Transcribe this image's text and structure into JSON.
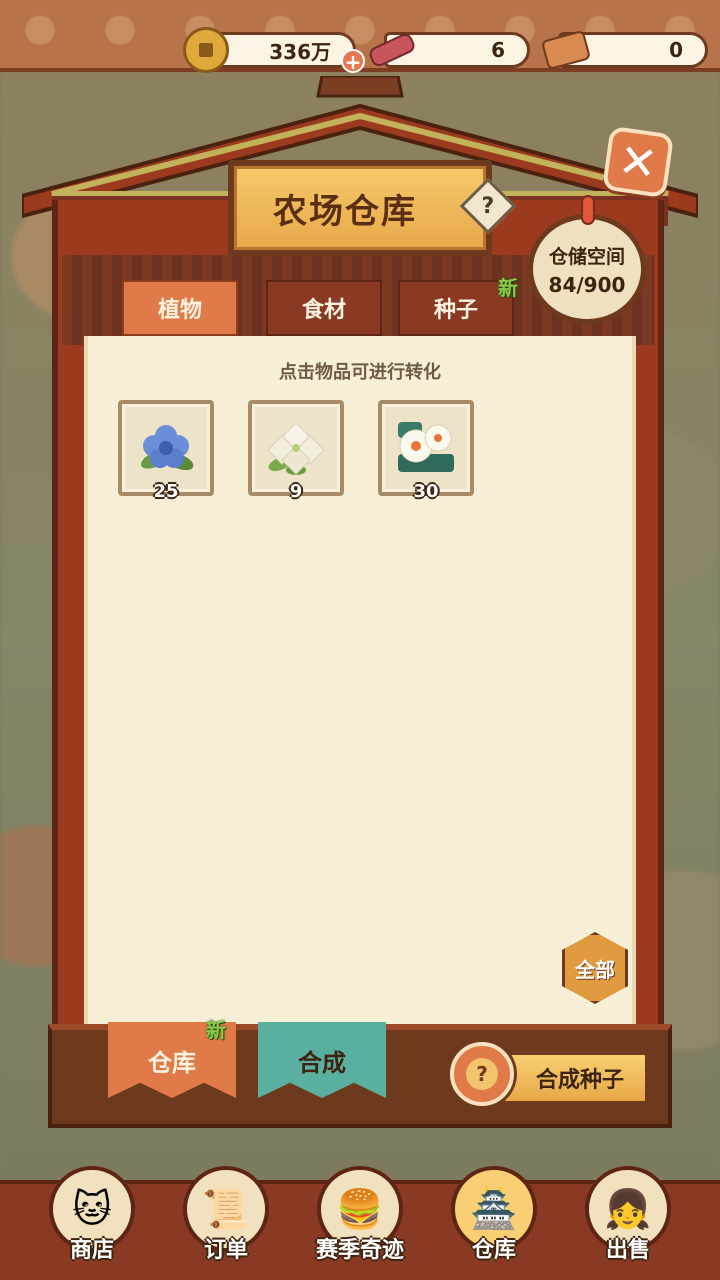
{
  "resources": {
    "coins": "336万",
    "bones": "6",
    "scrolls": "0"
  },
  "panel": {
    "title": "农场仓库",
    "storage_label": "仓储空间",
    "storage_value": "84/900",
    "hint": "点击物品可进行转化"
  },
  "tabs": [
    {
      "label": "植物",
      "active": true
    },
    {
      "label": "食材",
      "active": false
    },
    {
      "label": "种子",
      "active": false,
      "badge": "新"
    }
  ],
  "items": [
    {
      "icon": "blue-flower-icon",
      "qty": "25"
    },
    {
      "icon": "white-flower-icon",
      "qty": "9"
    },
    {
      "icon": "camellia-icon",
      "qty": "30"
    }
  ],
  "filter_all": "全部",
  "modes": [
    {
      "label": "仓库",
      "badge": "新",
      "active": true
    },
    {
      "label": "合成",
      "active": false
    }
  ],
  "synth_button": "合成种子",
  "nav": [
    {
      "label": "商店",
      "icon": "lucky-cat-icon"
    },
    {
      "label": "订单",
      "icon": "order-icon"
    },
    {
      "label": "赛季奇迹",
      "icon": "burger-icon"
    },
    {
      "label": "仓库",
      "icon": "warehouse-icon",
      "active": true
    },
    {
      "label": "出售",
      "icon": "character-icon"
    }
  ],
  "colors": {
    "accent": "#e07a48",
    "wood": "#6e3a1e",
    "paper": "#f8f0d6",
    "new_badge": "#8bc94a"
  }
}
